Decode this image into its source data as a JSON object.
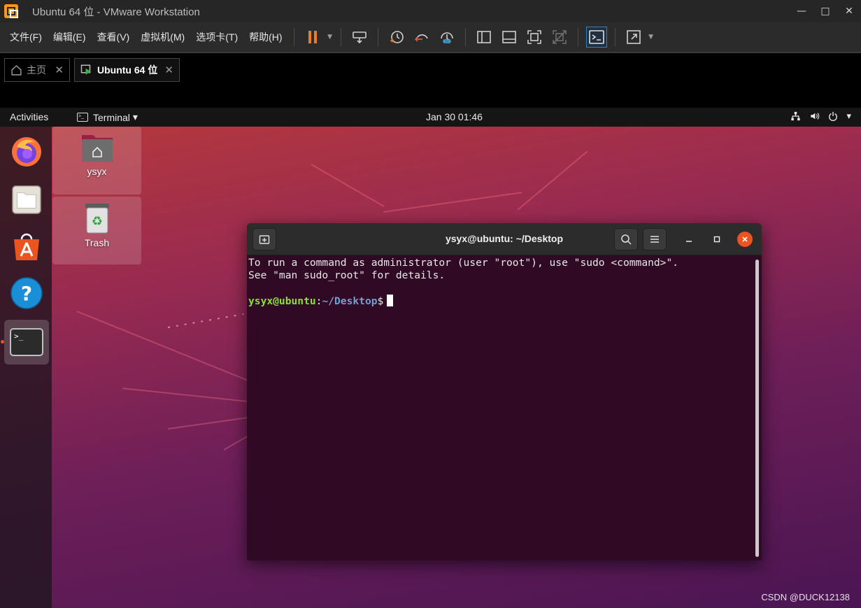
{
  "vm_window": {
    "title": "Ubuntu 64 位 - VMware Workstation",
    "controls": {
      "minimize": "—",
      "maximize": "□",
      "close": "✕"
    }
  },
  "menus": [
    "文件(F)",
    "编辑(E)",
    "查看(V)",
    "虚拟机(M)",
    "选项卡(T)",
    "帮助(H)"
  ],
  "tabs": {
    "home": {
      "label": "主页",
      "close": "✕"
    },
    "ubuntu": {
      "label": "Ubuntu 64 位",
      "close": "✕"
    }
  },
  "gnome": {
    "activities": "Activities",
    "app_menu": "Terminal",
    "app_menu_arrow": "▾",
    "clock": "Jan 30  01:46"
  },
  "desktop_icons": [
    {
      "label": "ysyx",
      "icon": "home-folder-icon"
    },
    {
      "label": "Trash",
      "icon": "trash-icon"
    }
  ],
  "dock_apps": [
    "firefox",
    "files",
    "ubuntu-software",
    "help",
    "terminal"
  ],
  "terminal": {
    "title": "ysyx@ubuntu: ~/Desktop",
    "lines": [
      "To run a command as administrator (user \"root\"), use \"sudo <command>\".",
      "See \"man sudo_root\" for details."
    ],
    "prompt_user": "ysyx@ubuntu",
    "prompt_sep": ":",
    "prompt_path": "~/Desktop",
    "prompt_symbol": "$"
  },
  "watermark": "CSDN @DUCK12138",
  "colors": {
    "accent_orange": "#e95420",
    "terminal_bg": "#300a24",
    "prompt_green": "#8ae234",
    "prompt_blue": "#729fcf"
  }
}
